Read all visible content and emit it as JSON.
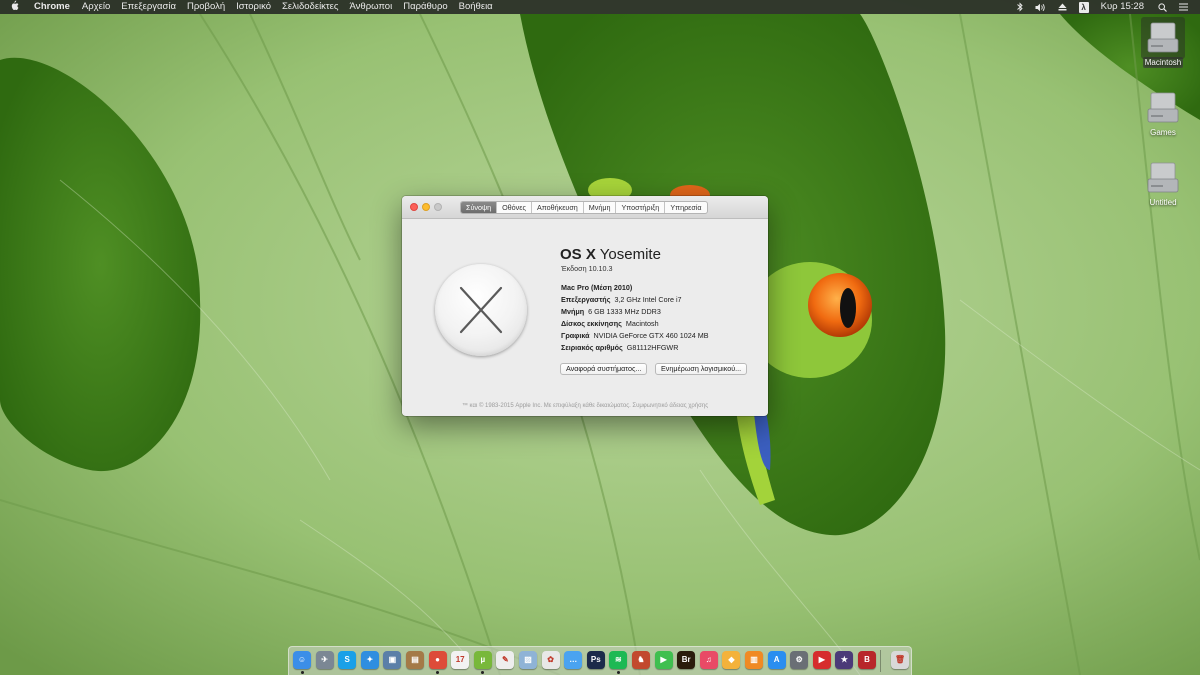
{
  "menubar": {
    "apple_icon": "",
    "app_name": "Chrome",
    "menus": [
      "Αρχείο",
      "Επεξεργασία",
      "Προβολή",
      "Ιστορικό",
      "Σελιδοδείκτες",
      "Άνθρωποι",
      "Παράθυρο",
      "Βοήθεια"
    ],
    "status": {
      "bluetooth_icon": "bluetooth-icon",
      "volume_icon": "volume-icon",
      "eject_icon": "eject-icon",
      "lambda_label": "λ",
      "clock": "Κυρ 15:28",
      "spotlight_icon": "search-icon",
      "list_icon": "notification-list-icon"
    }
  },
  "desktop": {
    "drives": [
      {
        "label": "Macintosh",
        "selected": true
      },
      {
        "label": "Games",
        "selected": false
      },
      {
        "label": "Untitled",
        "selected": false
      }
    ]
  },
  "about_window": {
    "tabs": [
      "Σύνοψη",
      "Οθόνες",
      "Αποθήκευση",
      "Μνήμη",
      "Υποστήριξη",
      "Υπηρεσία"
    ],
    "active_tab": 0,
    "os_name_bold": "OS X",
    "os_name_rest": " Yosemite",
    "version": "Έκδοση 10.10.3",
    "model": "Mac Pro (Μέση 2010)",
    "specs": [
      {
        "key": "Επεξεργαστής",
        "value": "3,2 GHz Intel Core i7"
      },
      {
        "key": "Μνήμη",
        "value": "6 GB 1333 MHz DDR3"
      },
      {
        "key": "Δίσκος εκκίνησης",
        "value": "Macintosh"
      },
      {
        "key": "Γραφικά",
        "value": "NVIDIA GeForce GTX 460 1024 MB"
      },
      {
        "key": "Σειριακός αριθμός",
        "value": "G81112HFGWR"
      }
    ],
    "buttons": {
      "report": "Αναφορά συστήματος...",
      "update": "Ενημέρωση λογισμικού..."
    },
    "footer": "™ και © 1983-2015 Apple Inc. Με επιφύλαξη κάθε δικαιώματος. Συμφωνητικό άδειας χρήσης"
  },
  "dock": {
    "apps": [
      {
        "name": "finder-icon",
        "glyph": "☺",
        "color": "#3b8ee8",
        "running": true
      },
      {
        "name": "launchpad-icon",
        "glyph": "✈",
        "color": "#7b8794",
        "running": false
      },
      {
        "name": "skype-icon",
        "glyph": "S",
        "color": "#1aa0e8",
        "running": false
      },
      {
        "name": "safari-icon",
        "glyph": "✦",
        "color": "#2f8ee0",
        "running": false
      },
      {
        "name": "preview-icon",
        "glyph": "▣",
        "color": "#5b7fa8",
        "running": false
      },
      {
        "name": "unarchiver-icon",
        "glyph": "▤",
        "color": "#a47a47",
        "running": false
      },
      {
        "name": "chrome-icon",
        "glyph": "●",
        "color": "#dd4b39",
        "running": true
      },
      {
        "name": "calendar-icon",
        "glyph": "17",
        "color": "#f2f2f2",
        "running": false
      },
      {
        "name": "utorrent-icon",
        "glyph": "µ",
        "color": "#78b83a",
        "running": true
      },
      {
        "name": "textedit-icon",
        "glyph": "✎",
        "color": "#eeeeee",
        "running": false
      },
      {
        "name": "iphoto-icon",
        "glyph": "▨",
        "color": "#8fb3d6",
        "running": false
      },
      {
        "name": "photos-icon",
        "glyph": "✿",
        "color": "#e8e8e8",
        "running": false
      },
      {
        "name": "messages-icon",
        "glyph": "…",
        "color": "#4aa3f0",
        "running": false
      },
      {
        "name": "photoshop-icon",
        "glyph": "Ps",
        "color": "#1c2a4a",
        "running": false
      },
      {
        "name": "spotify-icon",
        "glyph": "≋",
        "color": "#1db954",
        "running": true
      },
      {
        "name": "games-icon",
        "glyph": "♞",
        "color": "#c2492e",
        "running": false
      },
      {
        "name": "facetime-icon",
        "glyph": "▶",
        "color": "#3fbf4f",
        "running": false
      },
      {
        "name": "bridge-icon",
        "glyph": "Br",
        "color": "#2a1c0c",
        "running": false
      },
      {
        "name": "itunes-icon",
        "glyph": "♫",
        "color": "#e94a66",
        "running": false
      },
      {
        "name": "sketch-icon",
        "glyph": "◆",
        "color": "#f4b23b",
        "running": false
      },
      {
        "name": "ibooks-icon",
        "glyph": "▥",
        "color": "#f08a24",
        "running": false
      },
      {
        "name": "app-store-icon",
        "glyph": "A",
        "color": "#2a8ef0",
        "running": false
      },
      {
        "name": "system-preferences-icon",
        "glyph": "⚙",
        "color": "#6a6f75",
        "running": false
      },
      {
        "name": "youtube-icon",
        "glyph": "▶",
        "color": "#d62d2d",
        "running": false
      },
      {
        "name": "imovie-icon",
        "glyph": "★",
        "color": "#4b3a78",
        "running": false
      },
      {
        "name": "b-app-icon",
        "glyph": "B",
        "color": "#b8262a",
        "running": false
      },
      {
        "name": "trash-icon",
        "glyph": "🗑",
        "color": "#d9d9d9",
        "running": false
      }
    ]
  },
  "colors": {
    "menubar_bg": "#2c2f2a",
    "window_bg": "#ececec",
    "active_tab": "#777777",
    "close_light": "#fc5f57",
    "min_light": "#fdbc2e"
  }
}
